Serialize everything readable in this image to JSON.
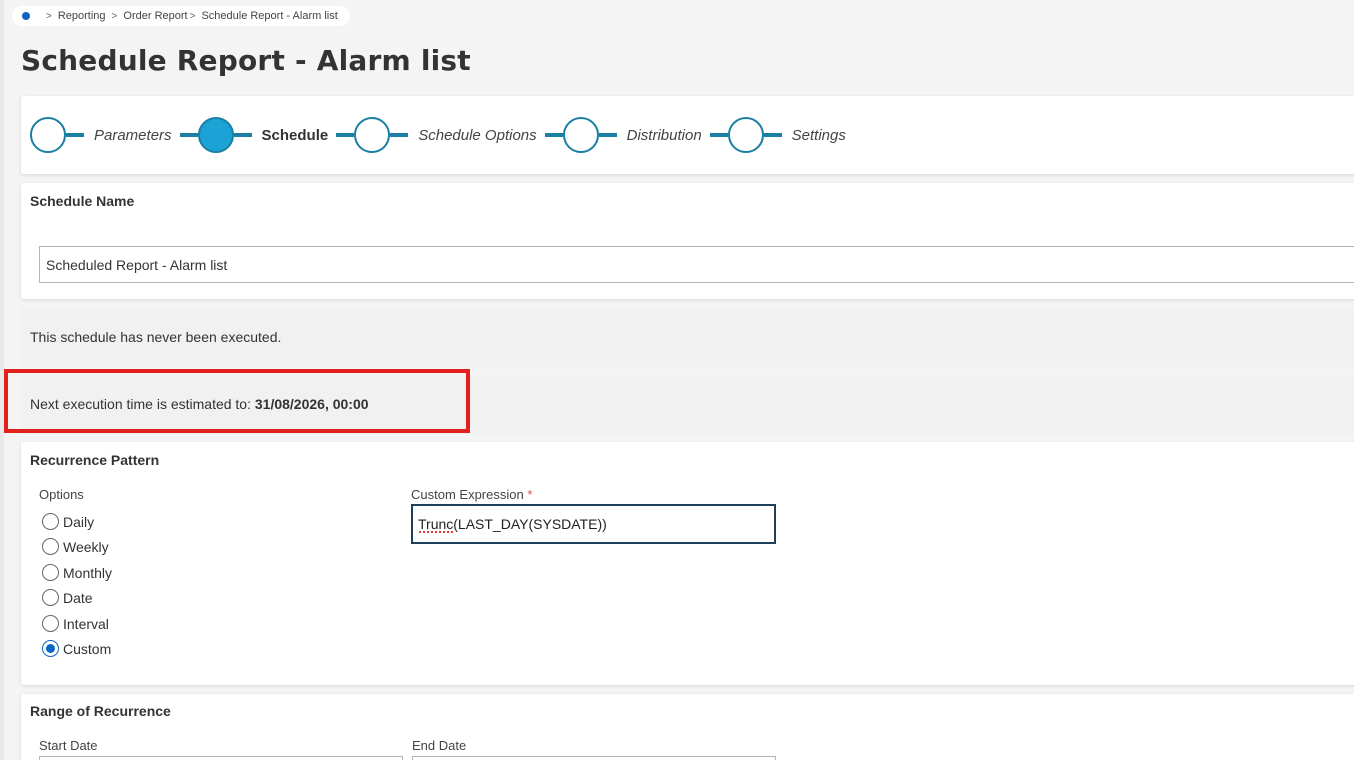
{
  "breadcrumb": {
    "items": [
      "Reporting",
      "Order Report",
      "Schedule Report - Alarm list"
    ]
  },
  "page": {
    "title": "Schedule Report - Alarm list"
  },
  "wizard": {
    "steps": [
      {
        "label": "Parameters",
        "active": false
      },
      {
        "label": "Schedule",
        "active": true
      },
      {
        "label": "Schedule Options",
        "active": false
      },
      {
        "label": "Distribution",
        "active": false
      },
      {
        "label": "Settings",
        "active": false
      }
    ]
  },
  "schedule_name": {
    "title": "Schedule Name",
    "value": "Scheduled Report - Alarm list"
  },
  "status": {
    "never_executed": "This schedule has never been executed.",
    "next_prefix": "Next execution time is estimated to: ",
    "next_time": "31/08/2026, 00:00"
  },
  "recurrence": {
    "title": "Recurrence Pattern",
    "options_label": "Options",
    "options": [
      "Daily",
      "Weekly",
      "Monthly",
      "Date",
      "Interval",
      "Custom"
    ],
    "selected": "Custom",
    "custom_label": "Custom Expression",
    "required_mark": "*",
    "custom_value": "Trunc(LAST_DAY(SYSDATE))"
  },
  "range": {
    "title": "Range of Recurrence",
    "start_label": "Start Date",
    "end_label": "End Date"
  },
  "colors": {
    "accent": "#1a7fa3",
    "active_step": "#1aa3d4",
    "highlight": "#e2201e",
    "radio_selected": "#0b65c2"
  }
}
